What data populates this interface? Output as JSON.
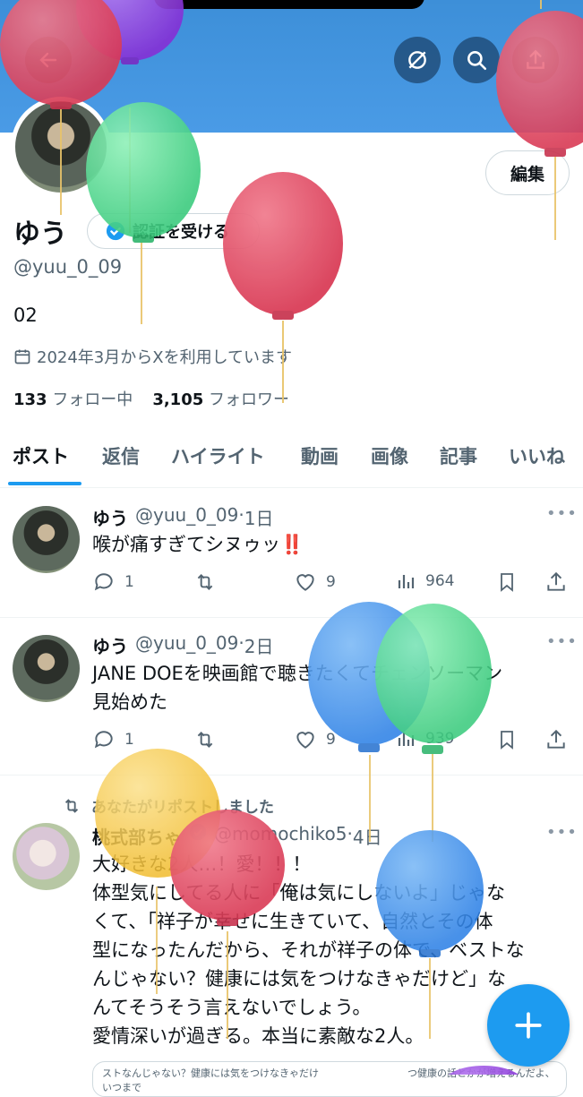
{
  "profile": {
    "name": "ゆう",
    "verify_label": "認証を受ける",
    "handle": "@yuu_0_09",
    "bio": "02",
    "joined": "2024年3月からXを利用しています",
    "following_count": "133",
    "following_label": "フォロー中",
    "followers_count": "3,105",
    "followers_label": "フォロワー",
    "edit_label": "編集"
  },
  "header_icons": [
    "back-arrow-icon",
    "grok-icon",
    "search-icon",
    "share-icon"
  ],
  "tabs": [
    {
      "label": "ポスト",
      "active": true
    },
    {
      "label": "返信",
      "active": false
    },
    {
      "label": "ハイライト",
      "active": false
    },
    {
      "label": "動画",
      "active": false
    },
    {
      "label": "画像",
      "active": false
    },
    {
      "label": "記事",
      "active": false
    },
    {
      "label": "いいね",
      "active": false
    }
  ],
  "posts": [
    {
      "name": "ゆう",
      "handle": "@yuu_0_09",
      "time": "1日",
      "text": "喉が痛すぎてシヌゥッ‼️",
      "replies": "1",
      "likes": "9",
      "views": "964"
    },
    {
      "name": "ゆう",
      "handle": "@yuu_0_09",
      "time": "2日",
      "text_line1": "JANE DOEを映画館で聴きたくてチェンソーマン",
      "text_line2": "見始めた",
      "replies": "1",
      "likes": "9",
      "views": "939"
    },
    {
      "repost_note": "あなたがリポストしました",
      "name": "桃式部ちゃ",
      "handle": "@momochiko5",
      "time": "4日",
      "lines": [
        "大好きな2人…！愛！！！",
        "体型気にしてる人に「俺は気にしないよ」じゃな",
        "くて、「祥子が幸せに生きていて、自然とその体",
        "型になったんだから、それが祥子の体で、ベストな",
        "んじゃない？健康には気をつけなきゃだけど」な",
        "んてそうそう言えないでしょう。",
        "愛情深いが過ぎる。本当に素敵な2人。"
      ],
      "card_text": "ストなんじゃない？健康には気をつけなきゃだけ　　　　　　　　　つ健康の話とかが増えるんだよ、いつまで"
    }
  ],
  "colors": {
    "accent": "#1d9bf0",
    "banner": "#4a9be6",
    "text_secondary": "#536471",
    "balloon_red": "#e0485e",
    "balloon_green": "#4fd08a",
    "balloon_blue": "#3f8fe8",
    "balloon_yellow": "#f5c542",
    "balloon_purple": "#8e3fd8"
  }
}
